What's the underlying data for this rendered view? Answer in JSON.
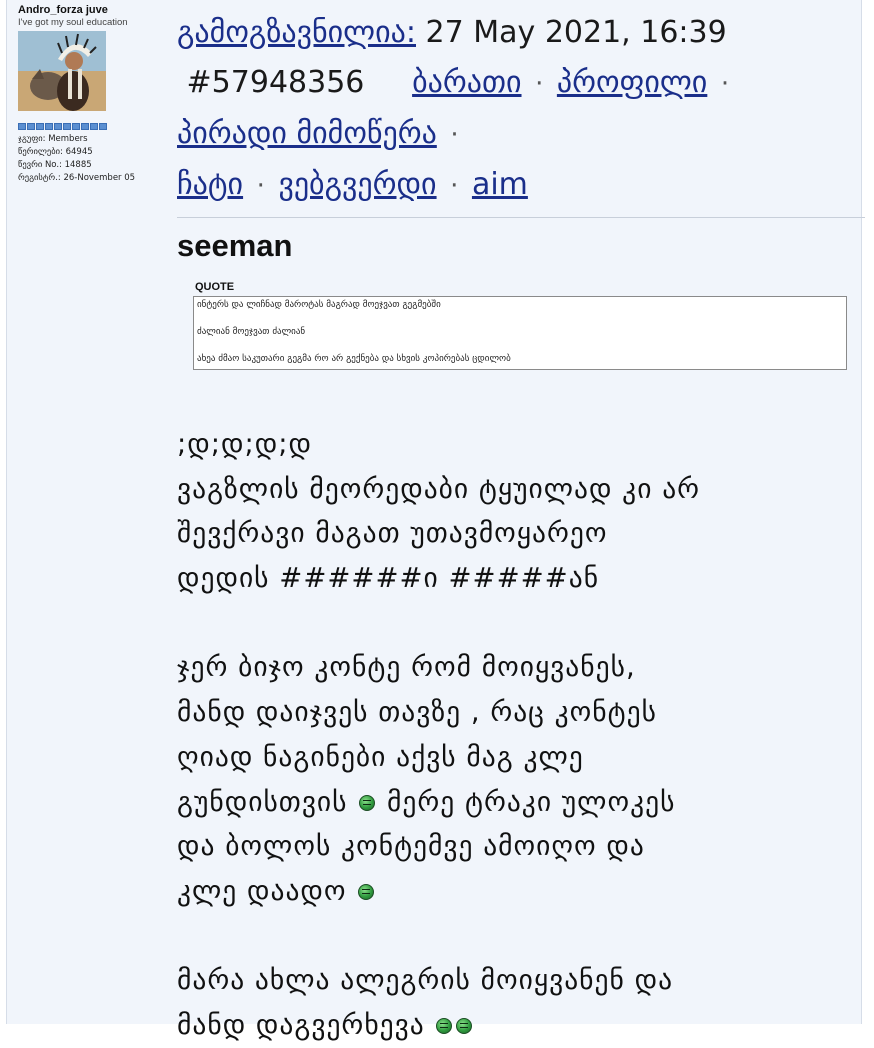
{
  "user": {
    "name": "Andro_forza juve",
    "tagline": "I've got my soul education",
    "avatar_icon": "avatar-native-chief-with-wolf",
    "rank_blocks": 10,
    "group": "ჯგუფი: Members",
    "posts": "წერილები: 64945",
    "member_no": "წევრი No.: 14885",
    "registered": "რეგისტრ.: 26-November 05"
  },
  "post_header": {
    "sent_label": "გამოგზავნილია:",
    "date": "27 May 2021, 16:39",
    "post_id": "#57948356",
    "links": {
      "card": "ბარათი",
      "profile": "პროფილი",
      "pm": "პირადი მიმოწერა",
      "chat": "ჩატი",
      "website": "ვებგვერდი",
      "aim": "aim"
    },
    "separator": "·"
  },
  "post": {
    "author": "seeman",
    "quote": {
      "label": "QUOTE",
      "lines": [
        "ინტერს და ლიჩნად მაროტას მაგრად მოეჯვათ გეგმებში",
        "ძალიან მოეჯვათ ძალიან",
        "ახეა ძმაო საკუთარი გეგმა რო არ გექნება და სხვის კოპირებას ცდილობ"
      ]
    },
    "body": {
      "p1": [
        ";დ;დ;დ;დ",
        "ვაგზლის მეორედაბი ტყუილად კი არ",
        "შევქრავი მაგათ უთავმოყარეო",
        "დედის ######ი #####ან"
      ],
      "p2": [
        "ჯერ ბიჯო კონტე რომ მოიყვანეს,",
        "მანდ დაიჯვეს თავზე , რაც კონტეს",
        "ღიად ნაგინები აქვს მაგ კლე",
        "გუნდისთვის",
        "მერე ტრაკი ულოკეს",
        "და ბოლოს კონტემვე ამოიღო და",
        "კლე დაადო"
      ],
      "p3": [
        "მარა ახლა ალეგრის მოიყვანენ და",
        "მანდ დაგვერხევა"
      ]
    },
    "emoticon_icon": "green-smiley-icon"
  }
}
